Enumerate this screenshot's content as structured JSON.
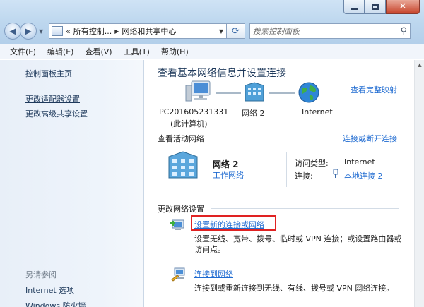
{
  "window": {
    "address_segments": [
      "«",
      "所有控制...",
      "网络和共享中心"
    ],
    "search_placeholder": "搜索控制面板",
    "close_glyph": "✕"
  },
  "menu": [
    "文件(F)",
    "编辑(E)",
    "查看(V)",
    "工具(T)",
    "帮助(H)"
  ],
  "sidebar": {
    "home": "控制面板主页",
    "links": [
      "更改适配器设置",
      "更改高级共享设置"
    ],
    "see_also_heading": "另请参阅",
    "see_also": [
      "Internet 选项",
      "Windows 防火墙"
    ]
  },
  "main": {
    "title": "查看基本网络信息并设置连接",
    "full_map": "查看完整映射",
    "nodes": [
      {
        "line1": "PC201605231331",
        "line2": "(此计算机)",
        "icon": "computer-icon"
      },
      {
        "line1": "网络  2",
        "line2": "",
        "icon": "building-icon"
      },
      {
        "line1": "Internet",
        "line2": "",
        "icon": "globe-icon"
      }
    ],
    "active_networks_label": "查看活动网络",
    "connect_disconnect": "连接或断开连接",
    "network": {
      "name": "网络  2",
      "type": "工作网络",
      "access_type_label": "访问类型:",
      "access_type_value": "Internet",
      "connection_label": "连接:",
      "connection_value": "本地连接 2"
    },
    "change_settings_label": "更改网络设置",
    "tasks": [
      {
        "title": "设置新的连接或网络",
        "desc": "设置无线、宽带、拨号、临时或 VPN 连接；或设置路由器或访问点。",
        "icon": "new-connection-icon"
      },
      {
        "title": "连接到网络",
        "desc": "连接到或重新连接到无线、有线、拨号或 VPN 网络连接。",
        "icon": "connect-network-icon"
      }
    ]
  },
  "colors": {
    "link": "#1f6bd1",
    "title": "#1e395b",
    "highlight": "#e02222"
  }
}
